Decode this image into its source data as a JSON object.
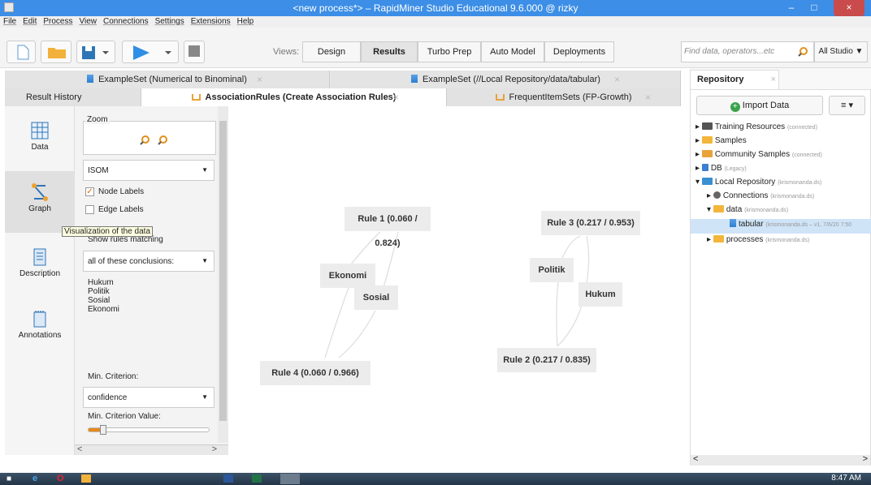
{
  "window": {
    "title": "<new process*> – RapidMiner Studio Educational 9.6.000 @ rizky",
    "min": "–",
    "max": "□",
    "close": "×"
  },
  "menu": [
    "File",
    "Edit",
    "Process",
    "View",
    "Connections",
    "Settings",
    "Extensions",
    "Help"
  ],
  "toolbar": {
    "views_label": "Views:",
    "views": [
      "Design",
      "Results",
      "Turbo Prep",
      "Auto Model",
      "Deployments"
    ],
    "active_view": "Results",
    "search_placeholder": "Find data, operators...etc",
    "scope": "All Studio ▼"
  },
  "tabs_row1": [
    {
      "label": "ExampleSet (Numerical to Binominal)"
    },
    {
      "label": "ExampleSet (//Local Repository/data/tabular)"
    }
  ],
  "tabs_row2": [
    {
      "label": "Result History"
    },
    {
      "label": "AssociationRules (Create Association Rules)",
      "active": true
    },
    {
      "label": "FrequentItemSets (FP-Growth)"
    }
  ],
  "close_glyph": "×",
  "sidenav": [
    "Data",
    "Graph",
    "Description",
    "Annotations"
  ],
  "params": {
    "zoom_label": "Zoom",
    "layout_value": "ISOM",
    "node_labels": "Node Labels",
    "edge_labels": "Edge Labels",
    "tooltip": "Visualization of the data",
    "show_rules": "Show rules matching",
    "match_mode": "all of these conclusions:",
    "conclusions": [
      "Hukum",
      "Politik",
      "Sosial",
      "Ekonomi"
    ],
    "min_criterion_label": "Min. Criterion:",
    "min_criterion_value": "confidence",
    "min_criterion_value_label": "Min. Criterion Value:"
  },
  "graph": {
    "rules": [
      "Rule 1 (0.060 / 0.824)",
      "Rule 3 (0.217 / 0.953)",
      "Rule 4 (0.060 / 0.966)",
      "Rule 2 (0.217 / 0.835)"
    ],
    "items": [
      "Ekonomi",
      "Sosial",
      "Politik",
      "Hukum"
    ]
  },
  "repository": {
    "tab_label": "Repository",
    "import_label": "Import Data",
    "menu_label": "≡ ▾",
    "tree": [
      {
        "label": "Training Resources",
        "sub": "(connected)"
      },
      {
        "label": "Samples",
        "sub": ""
      },
      {
        "label": "Community Samples",
        "sub": "(connected)"
      },
      {
        "label": "DB",
        "sub": "(Legacy)"
      },
      {
        "label": "Local Repository",
        "sub": "(krismonanda.ds)"
      },
      {
        "label": "Connections",
        "sub": "(krismonanda.ds)"
      },
      {
        "label": "data",
        "sub": "(krismonanda.ds)"
      },
      {
        "label": "tabular",
        "sub": "(krismonanda.ds – v1, 7/6/20 7:50"
      },
      {
        "label": "processes",
        "sub": "(krismonanda.ds)"
      }
    ]
  },
  "taskbar": {
    "time": "8:47 AM"
  }
}
